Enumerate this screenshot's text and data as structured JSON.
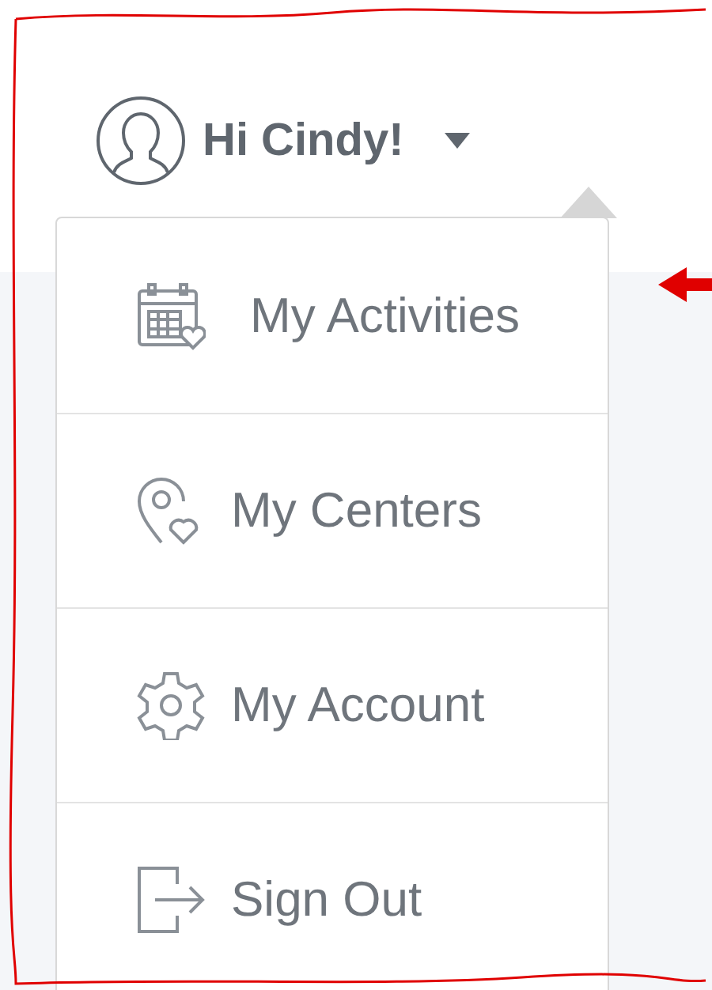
{
  "user_menu": {
    "greeting": "Hi Cindy!",
    "expanded": true
  },
  "menu_items": [
    {
      "label": "My Activities"
    },
    {
      "label": "My Centers"
    },
    {
      "label": "My Account"
    },
    {
      "label": "Sign Out"
    }
  ]
}
